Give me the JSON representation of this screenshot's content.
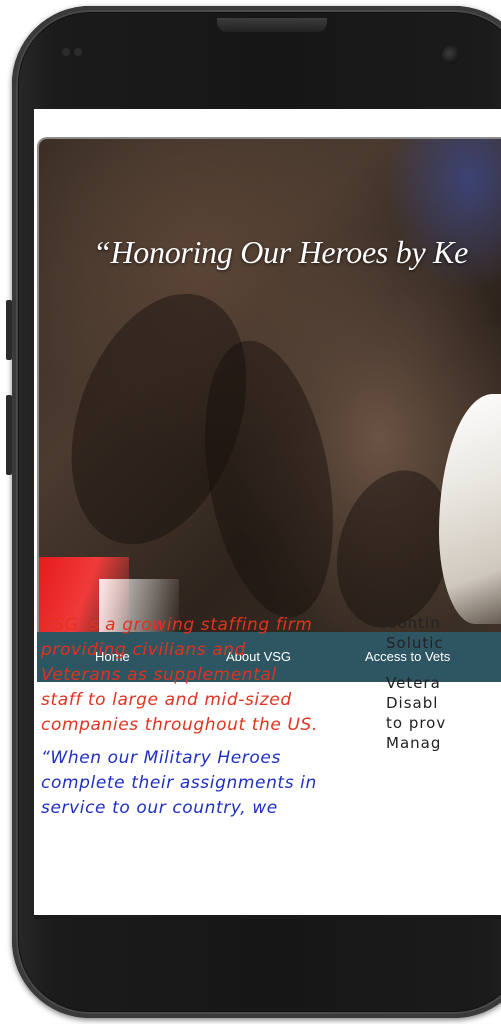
{
  "hero": {
    "quote": "“Honoring Our Heroes by Ke"
  },
  "nav": {
    "items": [
      {
        "label": "Home"
      },
      {
        "label": "About VSG"
      },
      {
        "label": "Access to Vets"
      }
    ]
  },
  "content": {
    "intro": "VSG is a growing staffing firm providing civilians and Veterans as supplemental staff to large and mid-sized companies throughout the US.",
    "quote_lines": [
      "“When our Military Heroes",
      "complete their assignments in",
      "service to our country, we"
    ],
    "intro_lines": [
      "VSG is a growing staffing firm",
      "providing civilians and",
      "Veterans as supplemental",
      "staff to large and mid-sized",
      "companies throughout the US."
    ],
    "right_block_1": [
      "Contin",
      "Solutic"
    ],
    "right_block_2": [
      "Vetera",
      "Disabl",
      "to prov",
      "Manag"
    ]
  },
  "colors": {
    "nav_background": "#2e5562",
    "intro_text": "#e0331f",
    "quote_text": "#1f2fc0",
    "phone_body": "#161616"
  },
  "icons": {
    "camera": "front-camera-icon",
    "speaker": "earpiece-speaker-icon"
  }
}
